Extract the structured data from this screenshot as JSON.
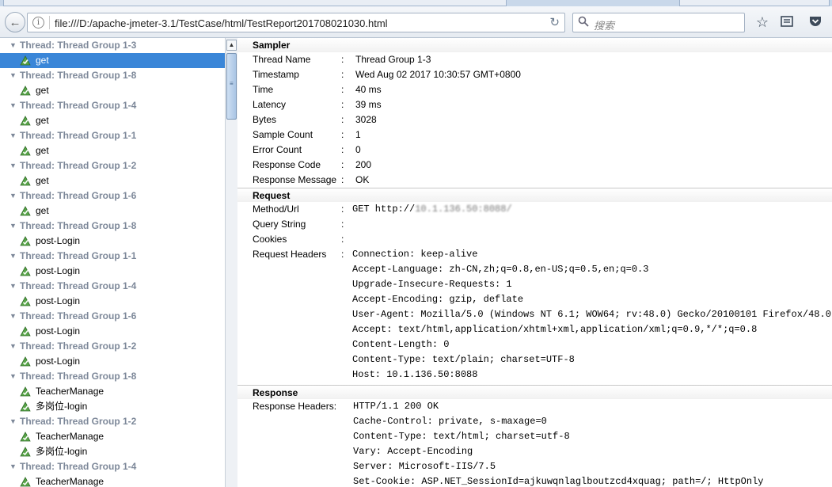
{
  "browser": {
    "url": "file:///D:/apache-jmeter-3.1/TestCase/html/TestReport201708021030.html",
    "search_placeholder": "搜索"
  },
  "tree": [
    {
      "thread": "Thread: Thread Group 1-3",
      "samples": [
        "get"
      ]
    },
    {
      "thread": "Thread: Thread Group 1-8",
      "samples": [
        "get"
      ]
    },
    {
      "thread": "Thread: Thread Group 1-4",
      "samples": [
        "get"
      ]
    },
    {
      "thread": "Thread: Thread Group 1-1",
      "samples": [
        "get"
      ]
    },
    {
      "thread": "Thread: Thread Group 1-2",
      "samples": [
        "get"
      ]
    },
    {
      "thread": "Thread: Thread Group 1-6",
      "samples": [
        "get"
      ]
    },
    {
      "thread": "Thread: Thread Group 1-8",
      "samples": [
        "post-Login"
      ]
    },
    {
      "thread": "Thread: Thread Group 1-1",
      "samples": [
        "post-Login"
      ]
    },
    {
      "thread": "Thread: Thread Group 1-4",
      "samples": [
        "post-Login"
      ]
    },
    {
      "thread": "Thread: Thread Group 1-6",
      "samples": [
        "post-Login"
      ]
    },
    {
      "thread": "Thread: Thread Group 1-2",
      "samples": [
        "post-Login"
      ]
    },
    {
      "thread": "Thread: Thread Group 1-8",
      "samples": [
        "TeacherManage",
        "多岗位-login"
      ]
    },
    {
      "thread": "Thread: Thread Group 1-2",
      "samples": [
        "TeacherManage",
        "多岗位-login"
      ]
    },
    {
      "thread": "Thread: Thread Group 1-4",
      "samples": [
        "TeacherManage"
      ]
    }
  ],
  "sampler": {
    "heading": "Sampler",
    "rows": [
      {
        "key": "Thread Name",
        "value": "Thread Group 1-3"
      },
      {
        "key": "Timestamp",
        "value": "Wed Aug 02 2017 10:30:57 GMT+0800"
      },
      {
        "key": "Time",
        "value": "40 ms"
      },
      {
        "key": "Latency",
        "value": "39 ms"
      },
      {
        "key": "Bytes",
        "value": "3028"
      },
      {
        "key": "Sample Count",
        "value": "1"
      },
      {
        "key": "Error Count",
        "value": "0"
      },
      {
        "key": "Response Code",
        "value": "200"
      },
      {
        "key": "Response Message",
        "value": "OK"
      }
    ]
  },
  "request": {
    "heading": "Request",
    "method_key": "Method/Url",
    "method_value": "GET http://",
    "method_blurred": "10.1.136.50:8088/",
    "query_key": "Query String",
    "cookies_key": "Cookies",
    "headers_key": "Request Headers",
    "headers": [
      "Connection: keep-alive",
      "Accept-Language: zh-CN,zh;q=0.8,en-US;q=0.5,en;q=0.3",
      "Upgrade-Insecure-Requests: 1",
      "Accept-Encoding: gzip, deflate",
      "User-Agent: Mozilla/5.0 (Windows NT 6.1; WOW64; rv:48.0) Gecko/20100101 Firefox/48.0",
      "Accept: text/html,application/xhtml+xml,application/xml;q=0.9,*/*;q=0.8",
      "Content-Length: 0",
      "Content-Type: text/plain; charset=UTF-8",
      "Host: 10.1.136.50:8088"
    ]
  },
  "response": {
    "heading": "Response",
    "headers_key": "Response Headers:",
    "headers": [
      "HTTP/1.1 200 OK",
      "Cache-Control: private, s-maxage=0",
      "Content-Type: text/html; charset=utf-8",
      "Vary: Accept-Encoding",
      "Server: Microsoft-IIS/7.5",
      "Set-Cookie: ASP.NET_SessionId=ajkuwqnlaglboutzcd4xquag; path=/; HttpOnly"
    ]
  },
  "colors": {
    "selected": "#3a86d8",
    "thread_text": "#7d8899"
  }
}
